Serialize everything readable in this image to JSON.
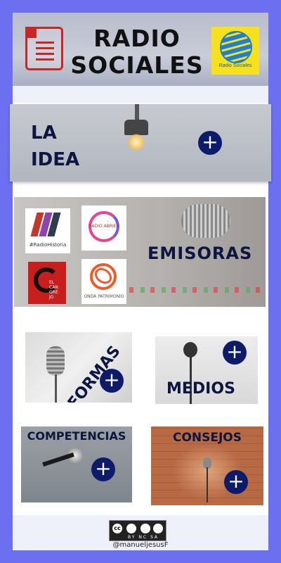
{
  "header": {
    "title": "RADIO SOCIALES",
    "logo_text": "Radio Sociales",
    "icons": {
      "document": "document-icon",
      "logo": "globe-logo-icon"
    }
  },
  "blocks": {
    "idea": {
      "label": "LA IDEA"
    },
    "emisoras": {
      "label": "EMISORAS",
      "stations": [
        {
          "name": "#RadioHistoria"
        },
        {
          "name": "RADIO ABRIEB"
        },
        {
          "name": "EL CAN GRE JO"
        },
        {
          "name": "ONDA PATRIMONIO"
        }
      ]
    },
    "formas": {
      "label": "FORMAS"
    },
    "medios": {
      "label": "MEDIOS"
    },
    "competencias": {
      "label": "COMPETENCIAS"
    },
    "consejos": {
      "label": "CONSEJOS"
    }
  },
  "plus_glyph": "+",
  "footer": {
    "license_labels": [
      "BY",
      "NC",
      "SA"
    ],
    "license_badge": "cc",
    "handle": "@manueljesusF"
  },
  "colors": {
    "background": "#6b6ff0",
    "accent": "#0d1b6b",
    "text": "#0c1640"
  }
}
